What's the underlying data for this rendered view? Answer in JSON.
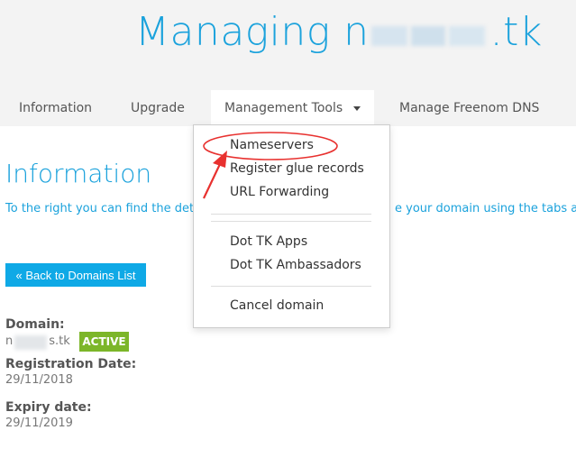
{
  "header": {
    "title_prefix": "Managing n",
    "title_suffix": ".tk"
  },
  "tabs": [
    {
      "label": "Information"
    },
    {
      "label": "Upgrade"
    },
    {
      "label": "Management Tools"
    },
    {
      "label": "Manage Freenom DNS"
    }
  ],
  "dropdown": {
    "items": [
      {
        "label": "Nameservers"
      },
      {
        "label": "Register glue records"
      },
      {
        "label": "URL Forwarding"
      },
      {
        "label": "Dot TK Apps"
      },
      {
        "label": "Dot TK Ambassadors"
      },
      {
        "label": "Cancel domain"
      }
    ]
  },
  "main": {
    "section_title": "Information",
    "intro_left": "To the right you can find the deta",
    "intro_right": "e your domain using the tabs abo",
    "back_button": "« Back to Domains List",
    "domain": {
      "label": "Domain:",
      "prefix": "n",
      "suffix": "s.tk",
      "status": "ACTIVE"
    },
    "registration": {
      "label": "Registration Date:",
      "value": "29/11/2018"
    },
    "expiry": {
      "label": "Expiry date:",
      "value": "29/11/2019"
    }
  },
  "colors": {
    "accent": "#1ba2dc",
    "button": "#0fa9e6",
    "status_active": "#7cb629",
    "annotation": "#e8312f",
    "header_bg": "#f3f3f3"
  },
  "icons": {
    "dropdown_caret": "caret-down-icon"
  }
}
